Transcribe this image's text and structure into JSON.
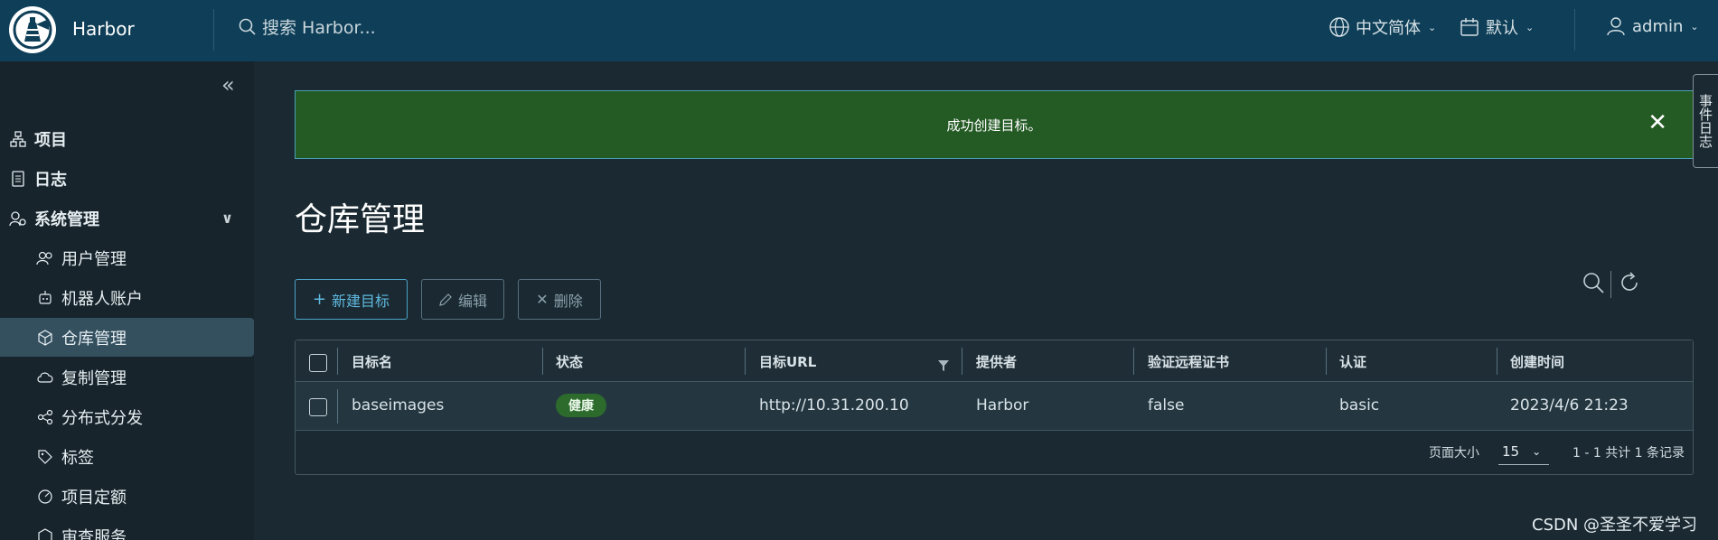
{
  "app": {
    "title": "Harbor"
  },
  "header": {
    "search_placeholder": "搜索 Harbor...",
    "language": "中文简体",
    "date_format": "默认",
    "user": "admin"
  },
  "sidebar": {
    "items": [
      {
        "label": "项目",
        "icon": "projects-icon"
      },
      {
        "label": "日志",
        "icon": "logs-icon"
      },
      {
        "label": "系统管理",
        "icon": "admin-icon"
      },
      {
        "label": "用户管理",
        "icon": "users-icon"
      },
      {
        "label": "机器人账户",
        "icon": "robot-icon"
      },
      {
        "label": "仓库管理",
        "icon": "registry-icon"
      },
      {
        "label": "复制管理",
        "icon": "replication-icon"
      },
      {
        "label": "分布式分发",
        "icon": "distribution-icon"
      },
      {
        "label": "标签",
        "icon": "tag-icon"
      },
      {
        "label": "项目定额",
        "icon": "quota-icon"
      },
      {
        "label": "审查服务",
        "icon": "service-icon"
      }
    ]
  },
  "alert": {
    "message": "成功创建目标。"
  },
  "event_tab": "事件日志",
  "page": {
    "title": "仓库管理"
  },
  "toolbar": {
    "new": "新建目标",
    "edit": "编辑",
    "delete": "删除"
  },
  "table": {
    "columns": [
      "目标名",
      "状态",
      "目标URL",
      "提供者",
      "验证远程证书",
      "认证",
      "创建时间"
    ],
    "rows": [
      {
        "name": "baseimages",
        "status": "健康",
        "url": "http://10.31.200.10",
        "provider": "Harbor",
        "verify_cert": "false",
        "auth": "basic",
        "created": "2023/4/6 21:23"
      }
    ]
  },
  "footer": {
    "page_size_label": "页面大小",
    "page_size": "15",
    "summary": "1 - 1 共计 1 条记录"
  },
  "watermark": "CSDN @圣圣不爱学习",
  "colors": {
    "header": "#0f3f58",
    "sidebar": "#17242b",
    "body": "#1b2a32",
    "alert": "#245a24",
    "badge": "#2c6b2c",
    "accent": "#4aa3c9"
  }
}
